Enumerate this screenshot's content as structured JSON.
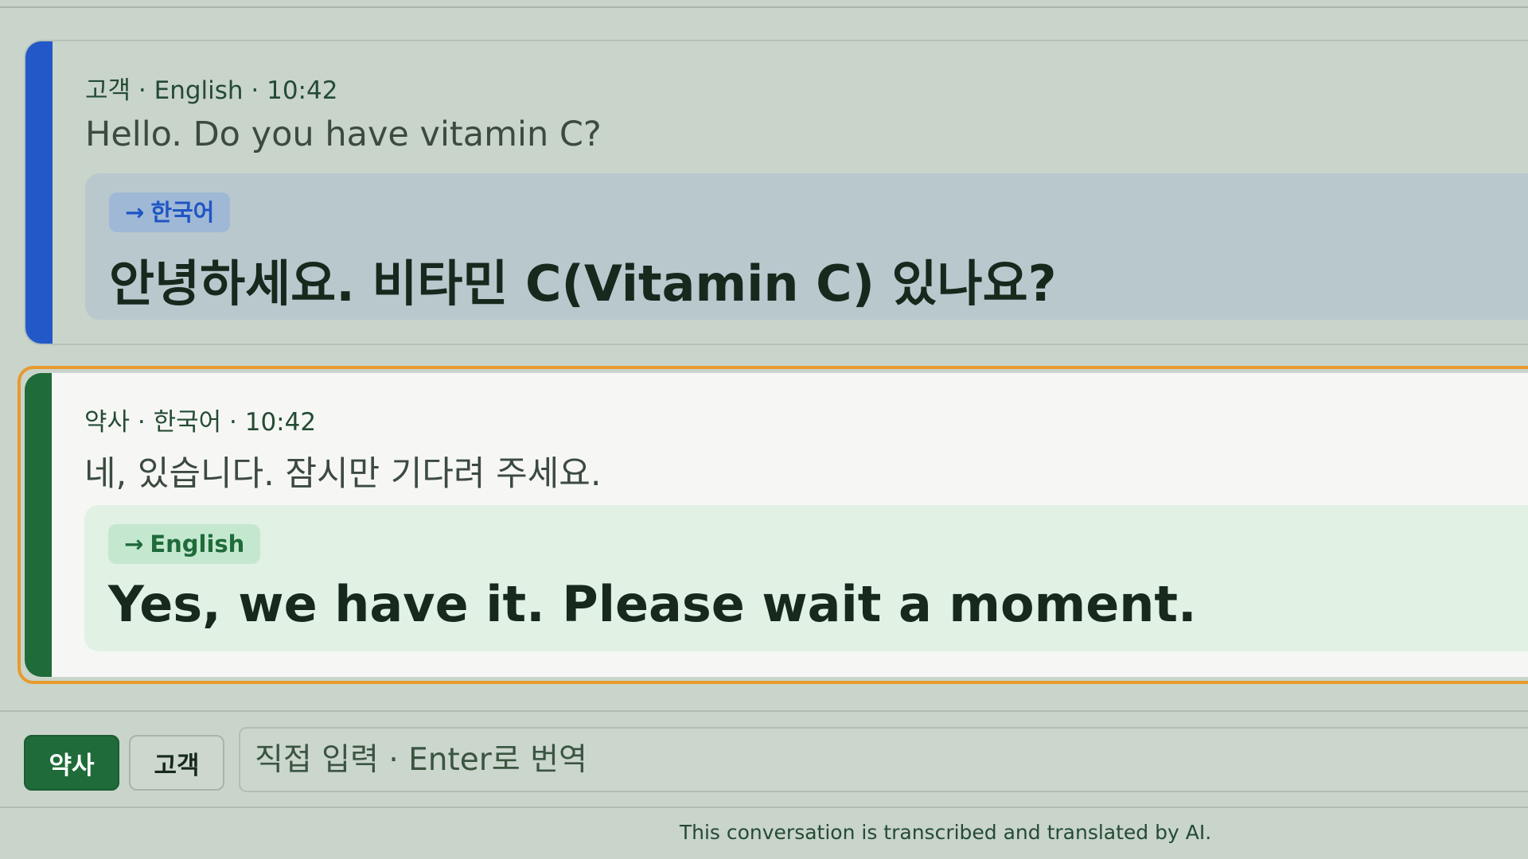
{
  "messages": [
    {
      "speaker": "고객",
      "language": "English",
      "time": "10:42",
      "meta": "고객 · English · 10:42",
      "original": "Hello. Do you have vitamin C?",
      "target_arrow": "→",
      "target_language": "한국어",
      "translation": "안녕하세요. 비타민 C(Vitamin C) 있나요?",
      "accent_color": "#2358c8"
    },
    {
      "speaker": "약사",
      "language": "한국어",
      "time": "10:42",
      "meta": "약사 · 한국어 · 10:42",
      "original": "네, 있습니다. 잠시만 기다려 주세요.",
      "target_arrow": "→",
      "target_language": "English",
      "translation": "Yes, we have it. Please wait a moment.",
      "accent_color": "#1f6b3a",
      "highlight_color": "#e89a2e"
    }
  ],
  "input_bar": {
    "pharmacist_button": "약사",
    "customer_button": "고객",
    "placeholder": "직접 입력 · Enter로 번역",
    "active_speaker": "약사"
  },
  "footer": {
    "disclaimer": "This conversation is transcribed and translated by AI."
  }
}
